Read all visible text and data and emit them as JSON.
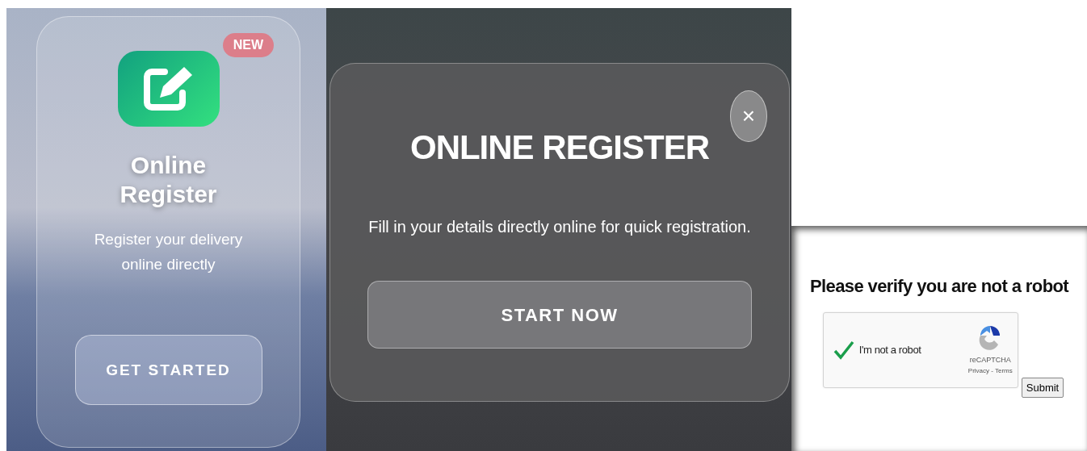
{
  "feature_card": {
    "badge": "NEW",
    "title": "Online Register",
    "description": "Register your delivery online directly",
    "button": "GET STARTED"
  },
  "modal": {
    "close": "×",
    "title": "ONLINE REGISTER",
    "text": "Fill in your details directly online for quick registration.",
    "button": "START NOW"
  },
  "verify": {
    "heading": "Please verify you are not a robot",
    "captcha": {
      "label": "I'm not a robot",
      "checked": true,
      "brand": "reCAPTCHA",
      "links": "Privacy - Terms"
    },
    "submit": "Submit"
  }
}
